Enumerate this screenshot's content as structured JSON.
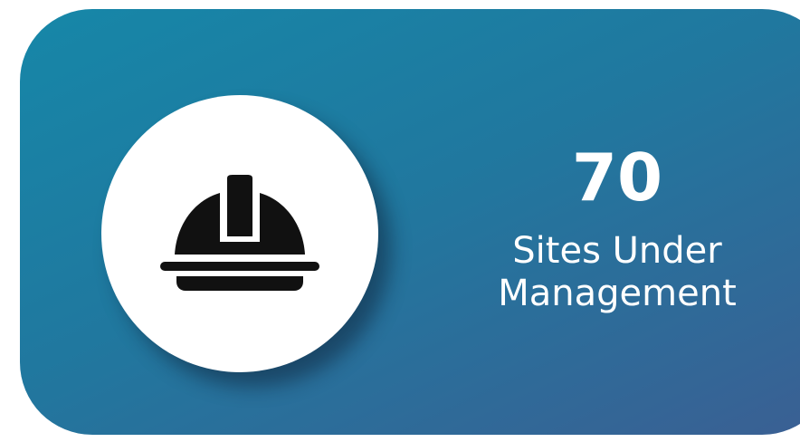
{
  "widget": {
    "icon": "hard-hat-icon",
    "value": "70",
    "label_line1": "Sites Under",
    "label_line2": "Management"
  },
  "colors": {
    "gradient_start": "#1687a8",
    "gradient_end": "#3b5f93",
    "circle": "#ffffff",
    "icon": "#111111",
    "text": "#ffffff"
  }
}
